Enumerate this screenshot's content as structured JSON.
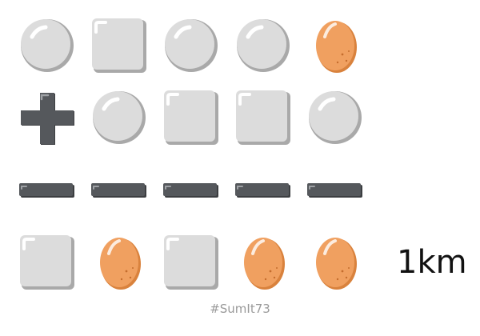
{
  "puzzle": {
    "rows": [
      [
        "circle",
        "square",
        "circle",
        "circle",
        "egg"
      ],
      [
        "circle",
        "square",
        "square",
        "circle"
      ],
      [
        "square",
        "egg",
        "square",
        "egg",
        "egg"
      ]
    ],
    "operator": "plus",
    "result": "1km",
    "hashtag": "#SumIt73"
  },
  "colors": {
    "tile": "#dcdcdc",
    "tile_shadow": "#a9a9a9",
    "egg": "#f0a060",
    "egg_shadow": "#d9823d",
    "operator": "#55585c",
    "result_text": "#111111",
    "hashtag_text": "#9a9a9a"
  }
}
